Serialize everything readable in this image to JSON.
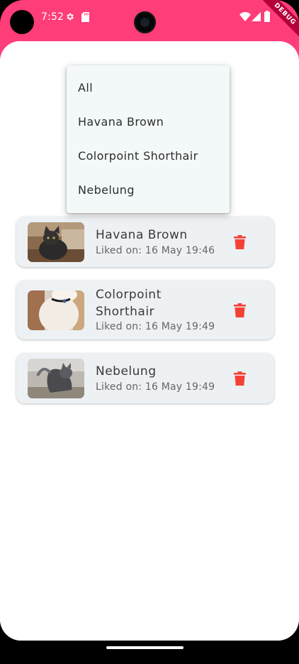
{
  "status_bar": {
    "time": "7:52",
    "debug_banner": "DEBUG"
  },
  "filter_menu": {
    "options": [
      "All",
      "Havana Brown",
      "Colorpoint Shorthair",
      "Nebelung"
    ]
  },
  "liked_cats": [
    {
      "title": "Havana Brown",
      "liked_on": "Liked on: 16 May 19:46",
      "image_icon": "cat-photo"
    },
    {
      "title": "Colorpoint Shorthair",
      "liked_on": "Liked on: 16 May 19:49",
      "image_icon": "cat-photo"
    },
    {
      "title": "Nebelung",
      "liked_on": "Liked on: 16 May 19:49",
      "image_icon": "cat-photo"
    }
  ],
  "colors": {
    "app_bar": "#ff3d78",
    "delete_icon": "#f44336",
    "card_bg": "#edf1f4",
    "menu_bg": "#f3f8f8"
  }
}
